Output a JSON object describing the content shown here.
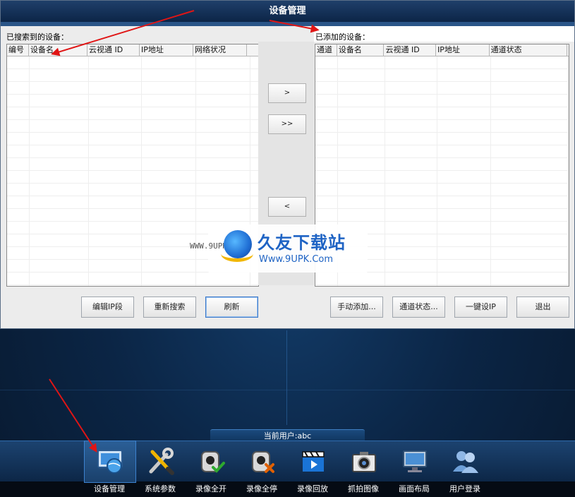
{
  "window": {
    "title": "设备管理"
  },
  "left_panel": {
    "label": "已搜索到的设备：",
    "columns": [
      "编号",
      "设备名",
      "云视通 ID",
      "IP地址",
      "网络状况"
    ]
  },
  "right_panel": {
    "label": "已添加的设备：",
    "columns": [
      "通道",
      "设备名",
      "云视通 ID",
      "IP地址",
      "通道状态"
    ]
  },
  "move_buttons": {
    "add_one": ">",
    "add_all": ">>",
    "remove_one": "<"
  },
  "bottom_buttons": {
    "edit_ip": "编辑IP段",
    "research": "重新搜索",
    "refresh": "刷新",
    "manual_add": "手动添加...",
    "channel_status": "通道状态...",
    "one_key_ip": "一键设IP",
    "exit": "退出"
  },
  "watermark": {
    "brand": "久友下载站",
    "url": "Www.9UPK.Com",
    "small": "WWW.9UPK.COM"
  },
  "status": {
    "current_user": "当前用户:abc"
  },
  "toolbar": [
    {
      "label": "设备管理",
      "icon": "device-manage-icon"
    },
    {
      "label": "系统参数",
      "icon": "wrench-screwdriver-icon"
    },
    {
      "label": "录像全开",
      "icon": "camera-record-on-icon"
    },
    {
      "label": "录像全停",
      "icon": "camera-record-off-icon"
    },
    {
      "label": "录像回放",
      "icon": "clapper-play-icon"
    },
    {
      "label": "抓拍图像",
      "icon": "photo-camera-icon"
    },
    {
      "label": "画面布局",
      "icon": "monitor-icon"
    },
    {
      "label": "用户登录",
      "icon": "users-icon"
    }
  ]
}
